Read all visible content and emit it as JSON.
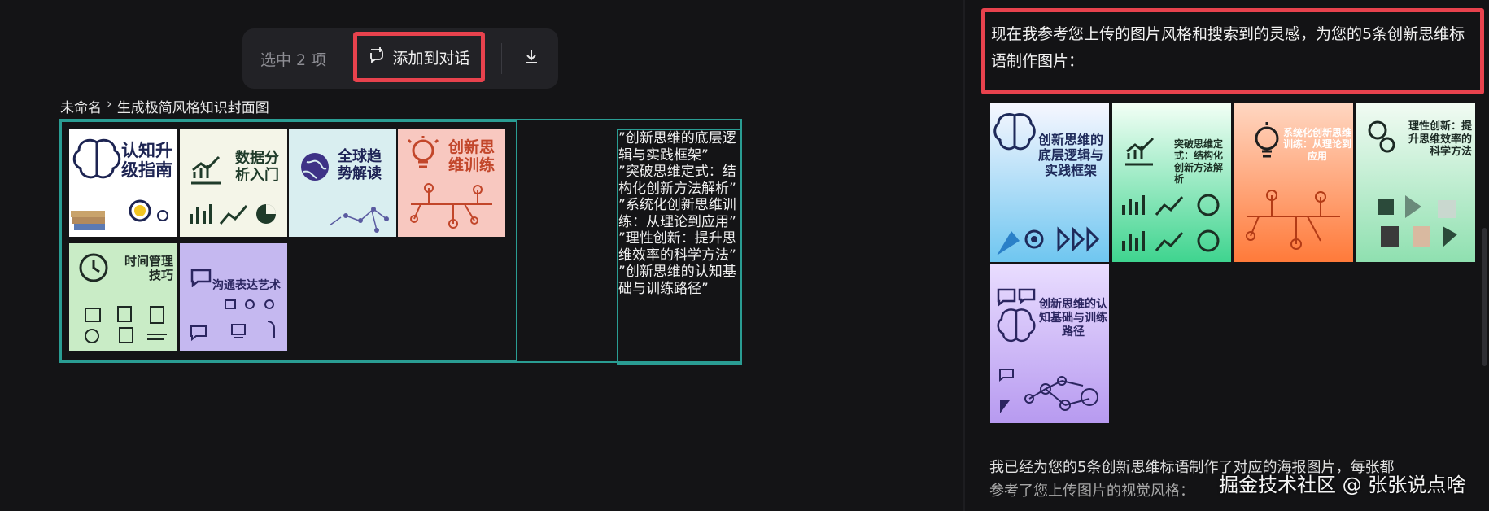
{
  "toolbar": {
    "selection_count": "选中 2 项",
    "add_to_chat_label": "添加到对话",
    "icons": [
      "add-to-chat-icon",
      "download-icon"
    ]
  },
  "breadcrumb": {
    "root": "未命名",
    "separator": "›",
    "current": "生成极简风格知识封面图"
  },
  "canvas_thumbs": [
    {
      "title": "认知升级指南",
      "bg": "#ffffff",
      "color": "#1d2452"
    },
    {
      "title": "数据分析入门",
      "bg": "#f4f5e8",
      "color": "#1f3b2a"
    },
    {
      "title": "全球趋势解读",
      "bg": "#d9eef0",
      "color": "#1e2356"
    },
    {
      "title": "创新思维训练",
      "bg": "#f8c8c0",
      "color": "#c2462a"
    },
    {
      "title": "时间管理技巧",
      "bg": "#c9ecc6",
      "color": "#1e2a24"
    },
    {
      "title": "沟通表达艺术",
      "bg": "#c5b8f0",
      "color": "#2b2560"
    }
  ],
  "slogans": [
    "”创新思维的底层逻辑与实践框架”",
    "”突破思维定式：结构化创新方法解析”",
    "”系统化创新思维训练：从理论到应用”",
    "”理性创新：提升思维效率的科学方法”",
    "”创新思维的认知基础与训练路径”"
  ],
  "chat": {
    "message": "现在我参考您上传的图片风格和搜索到的灵感，为您的5条创新思维标语制作图片：",
    "posters": [
      {
        "title": "创新思维的底层逻辑与实践框架",
        "bg": "linear-gradient(#f7f7ff,#6fc6f0)",
        "color": "#1e2a5a"
      },
      {
        "title": "突破思维定式：结构化创新方法解析",
        "bg": "linear-gradient(#f3fff6,#3fd48f)",
        "color": "#1b3024"
      },
      {
        "title": "系统化创新思维训练：从理论到应用",
        "bg": "linear-gradient(#ffd7c2,#ff7a3a)",
        "color": "#ffffff"
      },
      {
        "title": "理性创新：提升思维效率的科学方法",
        "bg": "linear-gradient(#f2fbf3,#8fe0b0)",
        "color": "#1c2a24"
      },
      {
        "title": "创新思维的认知基础与训练路径",
        "bg": "linear-gradient(#e9ddff,#b79af0)",
        "color": "#2b2560"
      }
    ],
    "reply_line1": "我已经为您的5条创新思维标语制作了对应的海报图片，每张都",
    "reply_line2": "参考了您上传图片的视觉风格："
  },
  "watermark": "掘金技术社区 @ 张张说点啥"
}
